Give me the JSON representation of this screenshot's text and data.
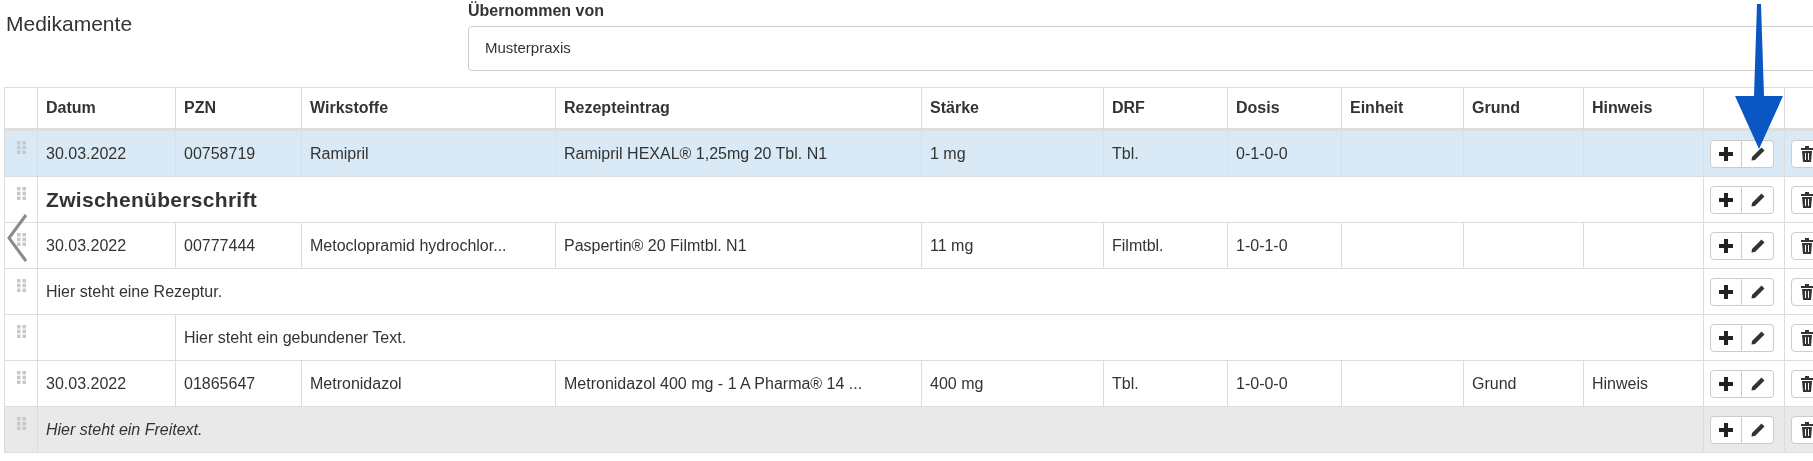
{
  "title": "Medikamente",
  "source": {
    "label": "Übernommen von",
    "value": "Musterpraxis"
  },
  "columns": [
    "Datum",
    "PZN",
    "Wirkstoffe",
    "Rezepteintrag",
    "Stärke",
    "DRF",
    "Dosis",
    "Einheit",
    "Grund",
    "Hinweis"
  ],
  "rows": [
    {
      "kind": "drug",
      "selected": true,
      "cells": [
        "30.03.2022",
        "00758719",
        "Ramipril",
        "Ramipril HEXAL® 1,25mg 20 Tbl. N1",
        "1 mg",
        "Tbl.",
        "0-1-0-0",
        null,
        null,
        null
      ]
    },
    {
      "kind": "heading",
      "selected": false,
      "text": "Zwischenüberschrift"
    },
    {
      "kind": "drug",
      "selected": false,
      "cells": [
        "30.03.2022",
        "00777444",
        "Metoclopramid hydrochlor...",
        "Paspertin® 20 Filmtbl. N1",
        "11 mg",
        "Filmtbl.",
        "1-0-1-0",
        null,
        null,
        null
      ]
    },
    {
      "kind": "recipe",
      "selected": false,
      "text": "Hier steht eine Rezeptur."
    },
    {
      "kind": "bound",
      "selected": false,
      "text": "Hier steht ein gebundener Text."
    },
    {
      "kind": "drug",
      "selected": false,
      "cells": [
        "30.03.2022",
        "01865647",
        "Metronidazol",
        "Metronidazol 400 mg - 1 A Pharma® 14 ...",
        "400 mg",
        "Tbl.",
        "1-0-0-0",
        null,
        "Grund",
        "Hinweis"
      ]
    },
    {
      "kind": "freetext",
      "selected": false,
      "text": "Hier steht ein Freitext."
    }
  ]
}
